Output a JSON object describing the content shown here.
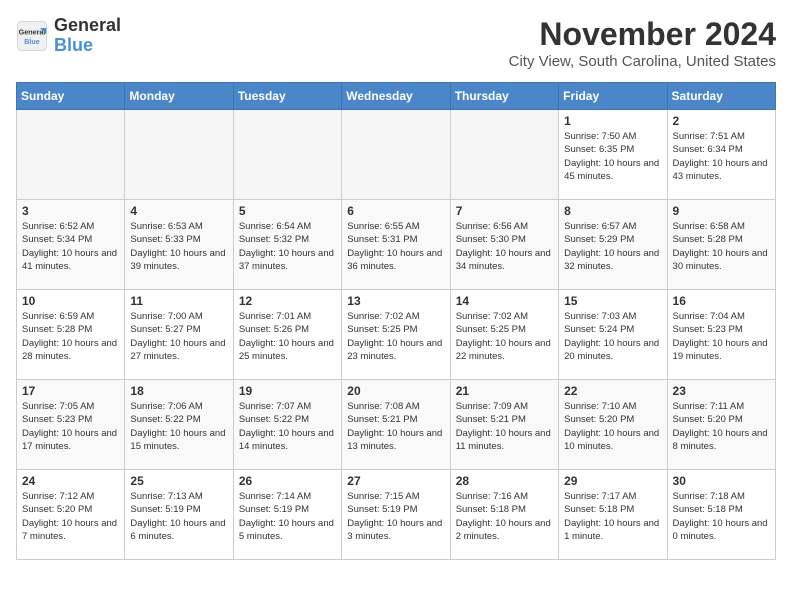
{
  "logo": {
    "text_general": "General",
    "text_blue": "Blue"
  },
  "header": {
    "month": "November 2024",
    "location": "City View, South Carolina, United States"
  },
  "weekdays": [
    "Sunday",
    "Monday",
    "Tuesday",
    "Wednesday",
    "Thursday",
    "Friday",
    "Saturday"
  ],
  "weeks": [
    [
      {
        "day": "",
        "empty": true
      },
      {
        "day": "",
        "empty": true
      },
      {
        "day": "",
        "empty": true
      },
      {
        "day": "",
        "empty": true
      },
      {
        "day": "",
        "empty": true
      },
      {
        "day": "1",
        "sunrise": "7:50 AM",
        "sunset": "6:35 PM",
        "daylight": "10 hours and 45 minutes."
      },
      {
        "day": "2",
        "sunrise": "7:51 AM",
        "sunset": "6:34 PM",
        "daylight": "10 hours and 43 minutes."
      }
    ],
    [
      {
        "day": "3",
        "sunrise": "6:52 AM",
        "sunset": "5:34 PM",
        "daylight": "10 hours and 41 minutes."
      },
      {
        "day": "4",
        "sunrise": "6:53 AM",
        "sunset": "5:33 PM",
        "daylight": "10 hours and 39 minutes."
      },
      {
        "day": "5",
        "sunrise": "6:54 AM",
        "sunset": "5:32 PM",
        "daylight": "10 hours and 37 minutes."
      },
      {
        "day": "6",
        "sunrise": "6:55 AM",
        "sunset": "5:31 PM",
        "daylight": "10 hours and 36 minutes."
      },
      {
        "day": "7",
        "sunrise": "6:56 AM",
        "sunset": "5:30 PM",
        "daylight": "10 hours and 34 minutes."
      },
      {
        "day": "8",
        "sunrise": "6:57 AM",
        "sunset": "5:29 PM",
        "daylight": "10 hours and 32 minutes."
      },
      {
        "day": "9",
        "sunrise": "6:58 AM",
        "sunset": "5:28 PM",
        "daylight": "10 hours and 30 minutes."
      }
    ],
    [
      {
        "day": "10",
        "sunrise": "6:59 AM",
        "sunset": "5:28 PM",
        "daylight": "10 hours and 28 minutes."
      },
      {
        "day": "11",
        "sunrise": "7:00 AM",
        "sunset": "5:27 PM",
        "daylight": "10 hours and 27 minutes."
      },
      {
        "day": "12",
        "sunrise": "7:01 AM",
        "sunset": "5:26 PM",
        "daylight": "10 hours and 25 minutes."
      },
      {
        "day": "13",
        "sunrise": "7:02 AM",
        "sunset": "5:25 PM",
        "daylight": "10 hours and 23 minutes."
      },
      {
        "day": "14",
        "sunrise": "7:02 AM",
        "sunset": "5:25 PM",
        "daylight": "10 hours and 22 minutes."
      },
      {
        "day": "15",
        "sunrise": "7:03 AM",
        "sunset": "5:24 PM",
        "daylight": "10 hours and 20 minutes."
      },
      {
        "day": "16",
        "sunrise": "7:04 AM",
        "sunset": "5:23 PM",
        "daylight": "10 hours and 19 minutes."
      }
    ],
    [
      {
        "day": "17",
        "sunrise": "7:05 AM",
        "sunset": "5:23 PM",
        "daylight": "10 hours and 17 minutes."
      },
      {
        "day": "18",
        "sunrise": "7:06 AM",
        "sunset": "5:22 PM",
        "daylight": "10 hours and 15 minutes."
      },
      {
        "day": "19",
        "sunrise": "7:07 AM",
        "sunset": "5:22 PM",
        "daylight": "10 hours and 14 minutes."
      },
      {
        "day": "20",
        "sunrise": "7:08 AM",
        "sunset": "5:21 PM",
        "daylight": "10 hours and 13 minutes."
      },
      {
        "day": "21",
        "sunrise": "7:09 AM",
        "sunset": "5:21 PM",
        "daylight": "10 hours and 11 minutes."
      },
      {
        "day": "22",
        "sunrise": "7:10 AM",
        "sunset": "5:20 PM",
        "daylight": "10 hours and 10 minutes."
      },
      {
        "day": "23",
        "sunrise": "7:11 AM",
        "sunset": "5:20 PM",
        "daylight": "10 hours and 8 minutes."
      }
    ],
    [
      {
        "day": "24",
        "sunrise": "7:12 AM",
        "sunset": "5:20 PM",
        "daylight": "10 hours and 7 minutes."
      },
      {
        "day": "25",
        "sunrise": "7:13 AM",
        "sunset": "5:19 PM",
        "daylight": "10 hours and 6 minutes."
      },
      {
        "day": "26",
        "sunrise": "7:14 AM",
        "sunset": "5:19 PM",
        "daylight": "10 hours and 5 minutes."
      },
      {
        "day": "27",
        "sunrise": "7:15 AM",
        "sunset": "5:19 PM",
        "daylight": "10 hours and 3 minutes."
      },
      {
        "day": "28",
        "sunrise": "7:16 AM",
        "sunset": "5:18 PM",
        "daylight": "10 hours and 2 minutes."
      },
      {
        "day": "29",
        "sunrise": "7:17 AM",
        "sunset": "5:18 PM",
        "daylight": "10 hours and 1 minute."
      },
      {
        "day": "30",
        "sunrise": "7:18 AM",
        "sunset": "5:18 PM",
        "daylight": "10 hours and 0 minutes."
      }
    ]
  ]
}
